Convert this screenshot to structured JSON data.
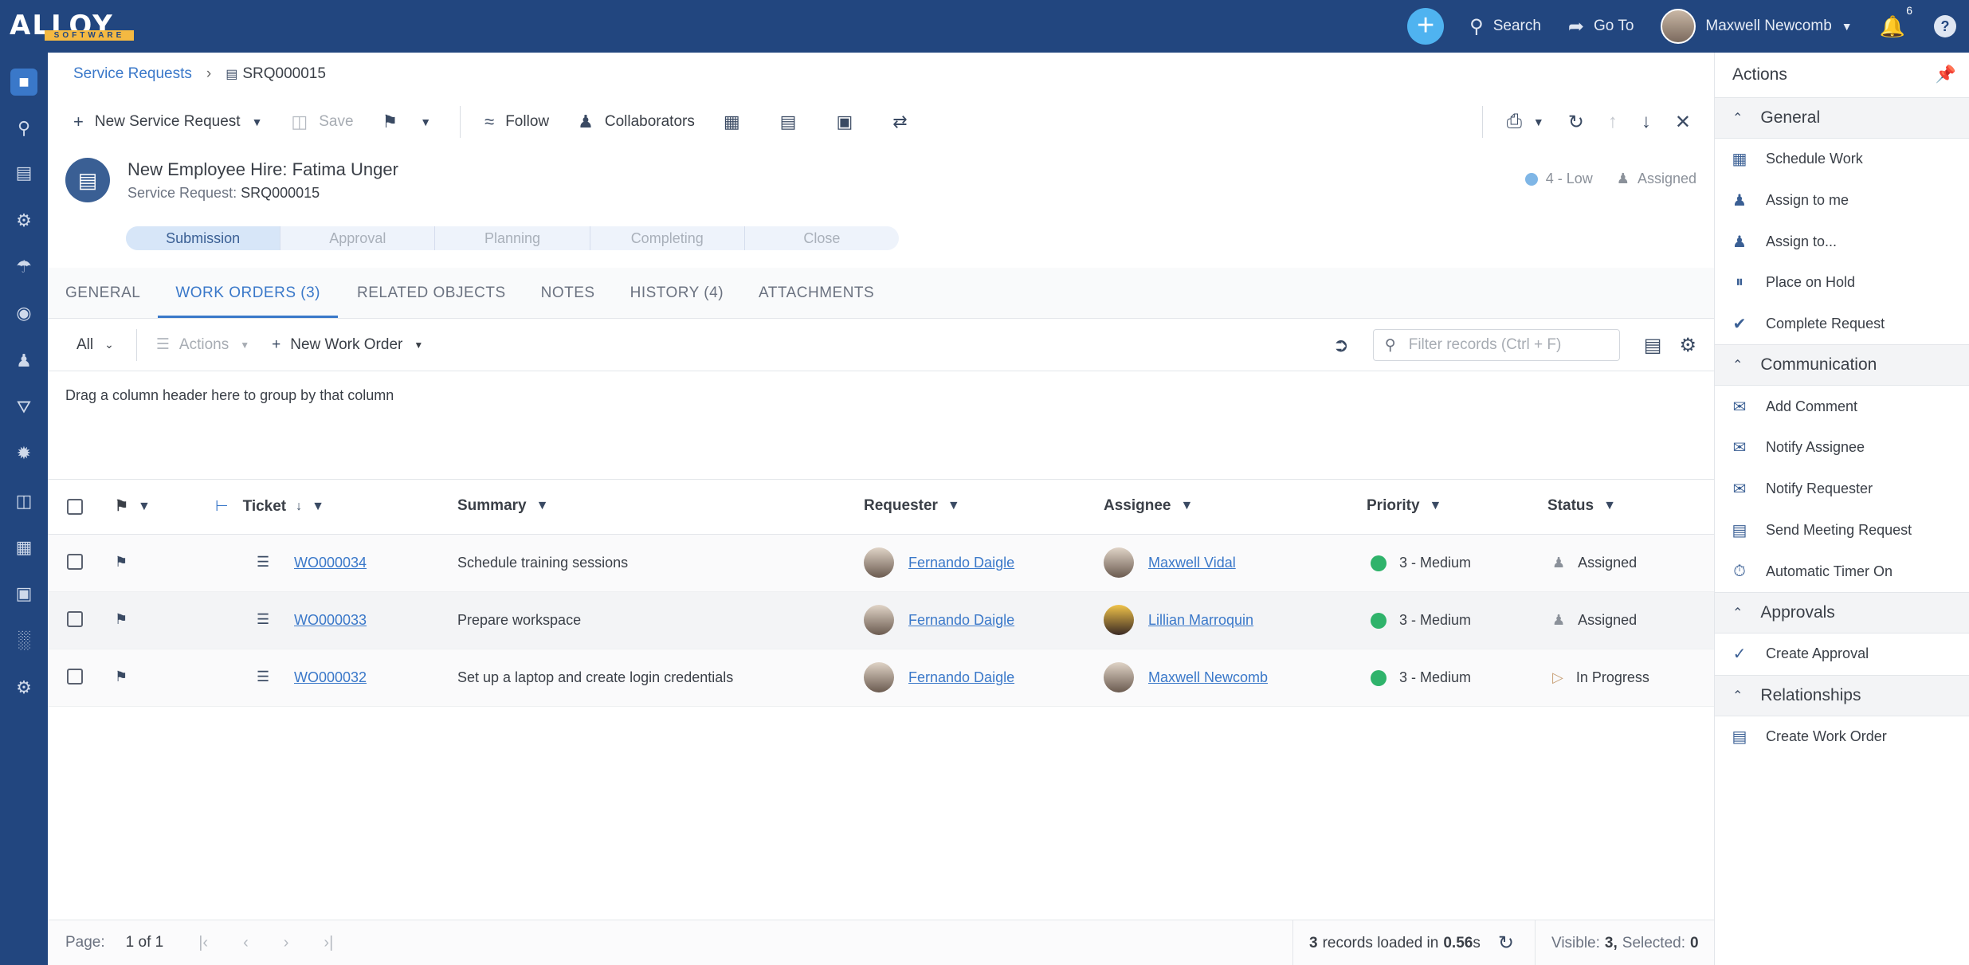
{
  "topbar": {
    "logo_text": "ALLOY",
    "logo_sub": "SOFTWARE",
    "search_label": "Search",
    "goto_label": "Go To",
    "user_name": "Maxwell Newcomb",
    "notifications_count": "6"
  },
  "breadcrumb": {
    "parent": "Service Requests",
    "current": "SRQ000015"
  },
  "toolbar": {
    "new_label": "New Service Request",
    "save_label": "Save",
    "follow_label": "Follow",
    "collaborators_label": "Collaborators"
  },
  "record": {
    "title": "New Employee Hire: Fatima Unger",
    "sub_prefix": "Service Request:",
    "id": "SRQ000015",
    "priority": "4 - Low",
    "status": "Assigned"
  },
  "stages": [
    "Submission",
    "Approval",
    "Planning",
    "Completing",
    "Close"
  ],
  "tabs": [
    "GENERAL",
    "WORK ORDERS (3)",
    "RELATED OBJECTS",
    "NOTES",
    "HISTORY (4)",
    "ATTACHMENTS"
  ],
  "grid_toolbar": {
    "view": "All",
    "actions": "Actions",
    "new_work_order": "New Work Order",
    "filter_placeholder": "Filter records (Ctrl + F)"
  },
  "group_hint": "Drag a column header here to group by that column",
  "columns": {
    "ticket": "Ticket",
    "summary": "Summary",
    "requester": "Requester",
    "assignee": "Assignee",
    "priority": "Priority",
    "status": "Status"
  },
  "rows": [
    {
      "ticket": "WO000034",
      "summary": "Schedule training sessions",
      "requester": "Fernando Daigle",
      "assignee": "Maxwell Vidal",
      "priority": "3 - Medium",
      "status": "Assigned"
    },
    {
      "ticket": "WO000033",
      "summary": "Prepare workspace",
      "requester": "Fernando Daigle",
      "assignee": "Lillian Marroquin",
      "priority": "3 - Medium",
      "status": "Assigned"
    },
    {
      "ticket": "WO000032",
      "summary": "Set up a laptop and create login credentials",
      "requester": "Fernando Daigle",
      "assignee": "Maxwell Newcomb",
      "priority": "3 - Medium",
      "status": "In Progress"
    }
  ],
  "pager": {
    "page_label": "Page:",
    "page_value": "1 of 1",
    "records_count": "3",
    "records_text": "records loaded in",
    "load_time": "0.56",
    "load_unit": "s",
    "visible_label": "Visible:",
    "visible_count": "3,",
    "selected_label": "Selected:",
    "selected_count": "0"
  },
  "actions_panel": {
    "title": "Actions",
    "sections": [
      {
        "name": "General",
        "items": [
          "Schedule Work",
          "Assign to me",
          "Assign to...",
          "Place on Hold",
          "Complete Request"
        ]
      },
      {
        "name": "Communication",
        "items": [
          "Add Comment",
          "Notify Assignee",
          "Notify Requester",
          "Send Meeting Request",
          "Automatic Timer On"
        ]
      },
      {
        "name": "Approvals",
        "items": [
          "Create Approval"
        ]
      },
      {
        "name": "Relationships",
        "items": [
          "Create Work Order"
        ]
      }
    ]
  },
  "colors": {
    "topbar": "#22467f",
    "accent": "#3a78c9",
    "priority_medium": "#2fb36b",
    "priority_low": "#7fb6e6"
  }
}
